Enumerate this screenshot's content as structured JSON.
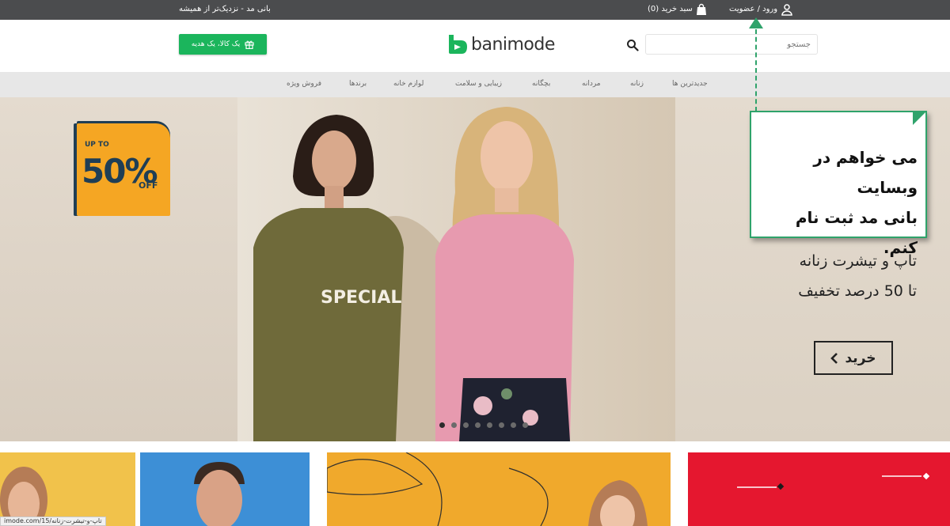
{
  "topbar": {
    "tagline": "بانی مد - نزدیک‌تر از همیشه",
    "cart_label": "سبد خرید (0)",
    "cart_icon": "shopping-bag-icon",
    "login_label": "ورود / عضویت",
    "user_icon": "user-icon"
  },
  "header": {
    "gift_button_label": "یک کالا، یک هدیه",
    "logo_text": "banimode",
    "search_placeholder": "جستجو",
    "search_icon": "search-icon"
  },
  "nav": {
    "items": [
      "جدیدترین ها",
      "زنانه",
      "مردانه",
      "بچگانه",
      "زیبایی و سلامت",
      "لوازم خانه",
      "برندها",
      "فروش ویژه"
    ]
  },
  "hero": {
    "badge_upto": "UP TO",
    "badge_percent": "50%",
    "badge_off": "OFF",
    "shirt_text": "SPECIAL",
    "promo_line1": "تاپ و تیشرت زنانه",
    "promo_line2": "تا 50 درصد تخفیف",
    "buy_button_label": "خرید",
    "slide_count": 8,
    "active_slide": 1
  },
  "callout": {
    "line1": "می خواهم در وبسایت",
    "line2": "بانی مد ثبت نام کنم."
  },
  "status_url": "imode.com/15/تاپ-و-تیشرت-زنانه",
  "colors": {
    "topbar": "#4b4c4e",
    "brand_green": "#1bb55c",
    "nav_bg": "#e7e7e7",
    "callout_green": "#2fa36b"
  }
}
